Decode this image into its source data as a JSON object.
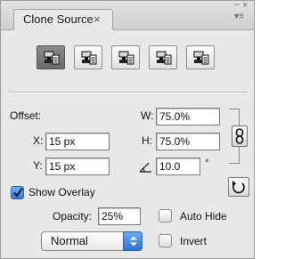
{
  "panel": {
    "tab_title": "Clone Source",
    "tab_close": "×",
    "collapse_glyph": "–",
    "close_glyph": "×",
    "menu_glyph": "▾≡"
  },
  "toolbar": {
    "buttons": [
      {
        "name": "clone-source-1",
        "icon": "clone-stamp-icon",
        "active": true
      },
      {
        "name": "clone-source-2",
        "icon": "clone-stamp-icon",
        "active": false
      },
      {
        "name": "clone-source-3",
        "icon": "clone-stamp-icon",
        "active": false
      },
      {
        "name": "clone-source-4",
        "icon": "clone-stamp-icon",
        "active": false
      },
      {
        "name": "clone-source-5",
        "icon": "clone-stamp-icon",
        "active": false
      }
    ]
  },
  "offset": {
    "label": "Offset:",
    "x_label": "X:",
    "x_value": "15 px",
    "y_label": "Y:",
    "y_value": "15 px",
    "w_label": "W:",
    "w_value": "75.0%",
    "h_label": "H:",
    "h_value": "75.0%",
    "angle_value": "10.0",
    "angle_unit": "°"
  },
  "overlay": {
    "show_overlay_label": "Show Overlay",
    "show_overlay_checked": true,
    "opacity_label": "Opacity:",
    "opacity_value": "25%",
    "auto_hide_label": "Auto Hide",
    "auto_hide_checked": false,
    "blend_mode": "Normal",
    "invert_label": "Invert",
    "invert_checked": false
  },
  "colors": {
    "panel_bg": "#e8e8e8",
    "active_button": "#7a7a7a",
    "checkbox_accent": "#2f7bd8"
  }
}
